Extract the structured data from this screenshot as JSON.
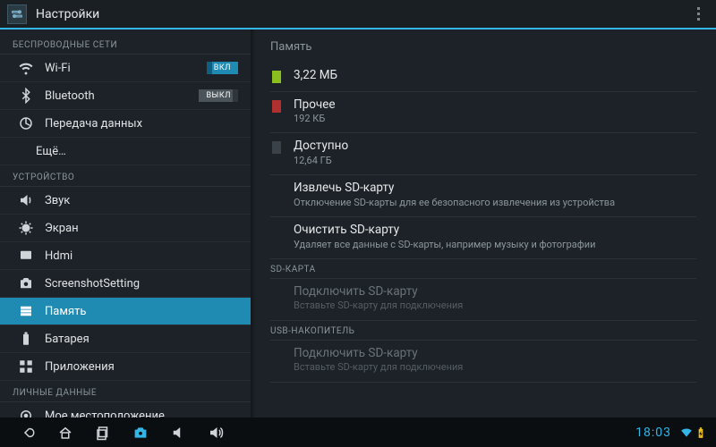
{
  "header": {
    "title": "Настройки"
  },
  "sidebar": {
    "cat_wireless": "БЕСПРОВОДНЫЕ СЕТИ",
    "cat_device": "УСТРОЙСТВО",
    "cat_personal": "ЛИЧНЫЕ ДАННЫЕ",
    "wifi": {
      "label": "Wi-Fi",
      "toggle": "ВКЛ"
    },
    "bluetooth": {
      "label": "Bluetooth",
      "toggle": "ВЫКЛ"
    },
    "data": "Передача данных",
    "more": "Ещё…",
    "sound": "Звук",
    "display": "Экран",
    "hdmi": "Hdmi",
    "screenshot": "ScreenshotSetting",
    "storage": "Память",
    "battery": "Батарея",
    "apps": "Приложения",
    "location": "Мое местоположение"
  },
  "detail": {
    "title": "Память",
    "internal_used": {
      "value": "3,22 МБ",
      "color": "#8abf1f"
    },
    "other": {
      "label": "Прочее",
      "value": "192 КБ",
      "color": "#b03030"
    },
    "available": {
      "label": "Доступно",
      "value": "12,64 ГБ",
      "color": "#3a4148"
    },
    "unmount": {
      "label": "Извлечь SD-карту",
      "sub": "Отключение SD-карты для ее безопасного извлечения из устройства"
    },
    "erase": {
      "label": "Очистить SD-карту",
      "sub": "Удаляет все данные с SD-карты, например музыку и фотографии"
    },
    "sdcard_header": "SD-КАРТА",
    "sdcard_mount": {
      "label": "Подключить SD-карту",
      "sub": "Вставьте SD-карту для подключения"
    },
    "usb_header": "USB-НАКОПИТЕЛЬ",
    "usb_mount": {
      "label": "Подключить SD-карту",
      "sub": "Вставьте SD-карту для подключения"
    }
  },
  "navbar": {
    "clock": "18:03"
  }
}
